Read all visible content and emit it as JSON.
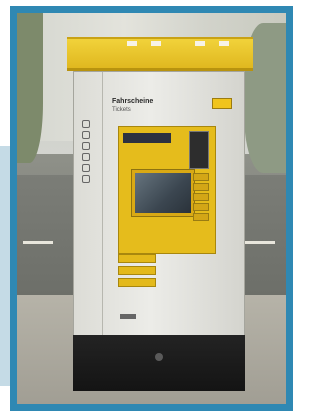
{
  "photo": {
    "subject": "ticket-vending-machine",
    "machine": {
      "sign_title": "Fahrscheine",
      "sign_subtitle": "Tickets"
    }
  },
  "colors": {
    "frame": "#2f88b3",
    "side_panel": "#c5dbe6",
    "machine_yellow": "#e5bc1c",
    "machine_base": "#1b1b1b"
  }
}
